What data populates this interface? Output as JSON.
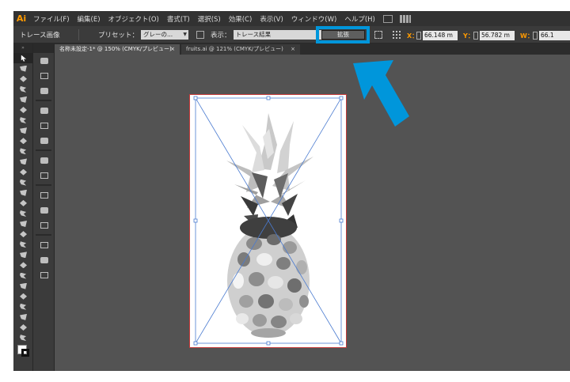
{
  "menubar": {
    "logo": "Ai",
    "items": [
      "ファイル(F)",
      "編集(E)",
      "オブジェクト(O)",
      "書式(T)",
      "選択(S)",
      "効果(C)",
      "表示(V)",
      "ウィンドウ(W)",
      "ヘルプ(H)"
    ]
  },
  "controlbar": {
    "trace_label": "トレース画像",
    "preset_label": "プリセット：",
    "preset_value": "グレーの...",
    "view_label": "表示：",
    "view_value": "トレース結果",
    "expand_label": "拡張",
    "x_label": "X：",
    "x_value": "66.148 m",
    "y_label": "Y：",
    "y_value": "56.782 m",
    "w_label": "W：",
    "w_value": "66.1"
  },
  "tabs": [
    {
      "label": "名称未設定-1* @ 150% (CMYK/プレビュー)",
      "close": "×"
    },
    {
      "label": "fruits.ai @ 121% (CMYK/プレビュー)",
      "close": "×"
    }
  ],
  "tools": {
    "header": "»"
  },
  "colors": {
    "highlight": "#0096db",
    "artboard_border": "#c43a3a",
    "accent": "#ff9a00"
  }
}
